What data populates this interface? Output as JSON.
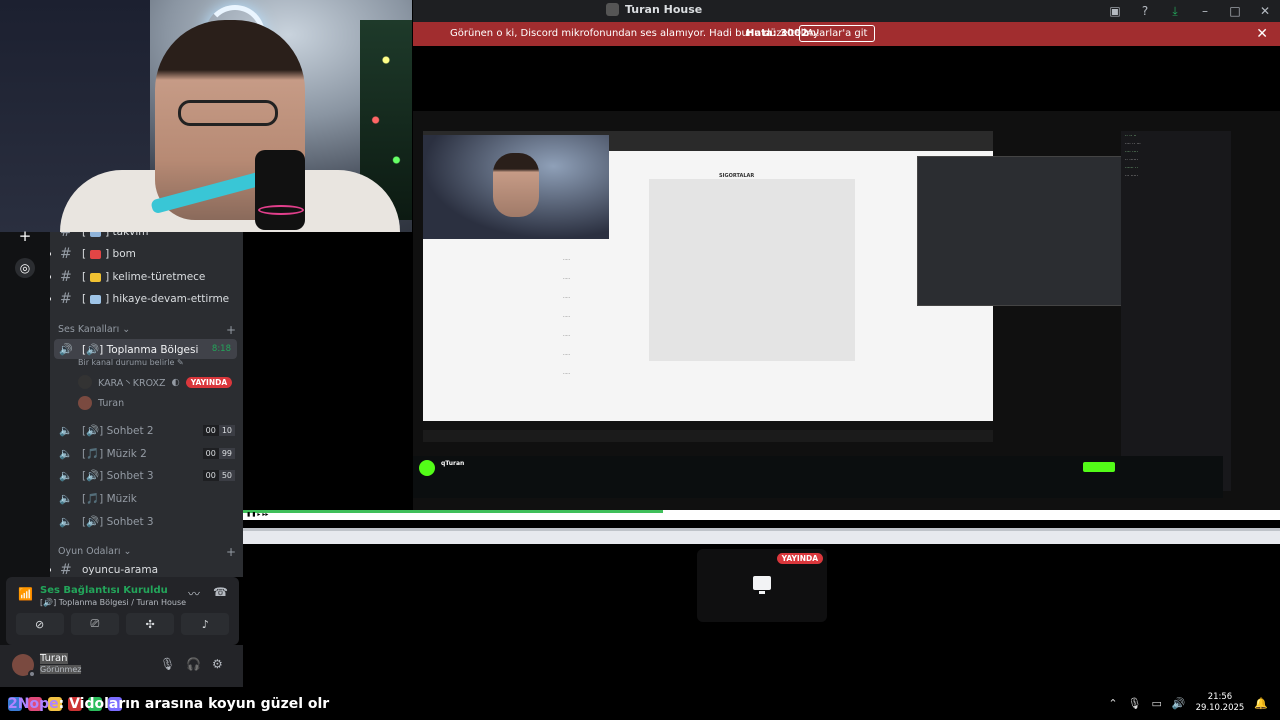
{
  "window": {
    "title": "Turan House",
    "icons": [
      "inbox-icon",
      "help-icon",
      "download-icon",
      "minimize-icon",
      "maximize-icon",
      "close-icon"
    ]
  },
  "banner": {
    "message": "Görünen o ki, Discord mikrofonundan ses alamıyor. Hadi bunu düzeltelim!",
    "code": "Hata: 3002",
    "button": "Ayarlar'a git",
    "color": "#a12d2f"
  },
  "sidebar": {
    "text_channels": [
      {
        "name": "takvim",
        "emoji": "📅"
      },
      {
        "name": "bom",
        "emoji": "💥"
      },
      {
        "name": "kelime-türetmece",
        "emoji": "📒"
      },
      {
        "name": "hikaye-devam-ettirme",
        "emoji": "📖"
      }
    ],
    "voice_category": "Ses Kanalları",
    "active_voice": {
      "name": "Toplanma Bölgesi",
      "time": "8:18",
      "status": "Bir kanal durumu belirle",
      "members": [
        {
          "name": "KARA丶KROXZ",
          "live": "YAYINDA"
        },
        {
          "name": "Turan"
        }
      ]
    },
    "voice_channels": [
      {
        "name": "Sohbet 2",
        "counts": [
          "00",
          "10"
        ]
      },
      {
        "name": "Müzik 2",
        "counts": [
          "00",
          "99"
        ]
      },
      {
        "name": "Sohbet 3",
        "counts": [
          "00",
          "50"
        ]
      },
      {
        "name": "Müzik",
        "counts": []
      },
      {
        "name": "Sohbet 3",
        "counts": []
      }
    ],
    "game_category": "Oyun Odaları",
    "game_channel": "oyuncu-arama"
  },
  "voice_panel": {
    "status": "Ses Bağlantısı Kuruldu",
    "location": "Toplanma Bölgesi / Turan House",
    "accent": "#23a55a"
  },
  "user": {
    "name": "Turan",
    "status": "Görünmez"
  },
  "stream": {
    "live_badge": "YAYINDA",
    "kick_channel": "qTuran",
    "form_header": "SIGORTALAR"
  },
  "caption": {
    "user": "2Nope",
    "text": ": Vidoların arasına koyun güzel olr"
  },
  "clock": {
    "time": "21:56",
    "date": "29.10.2025"
  }
}
